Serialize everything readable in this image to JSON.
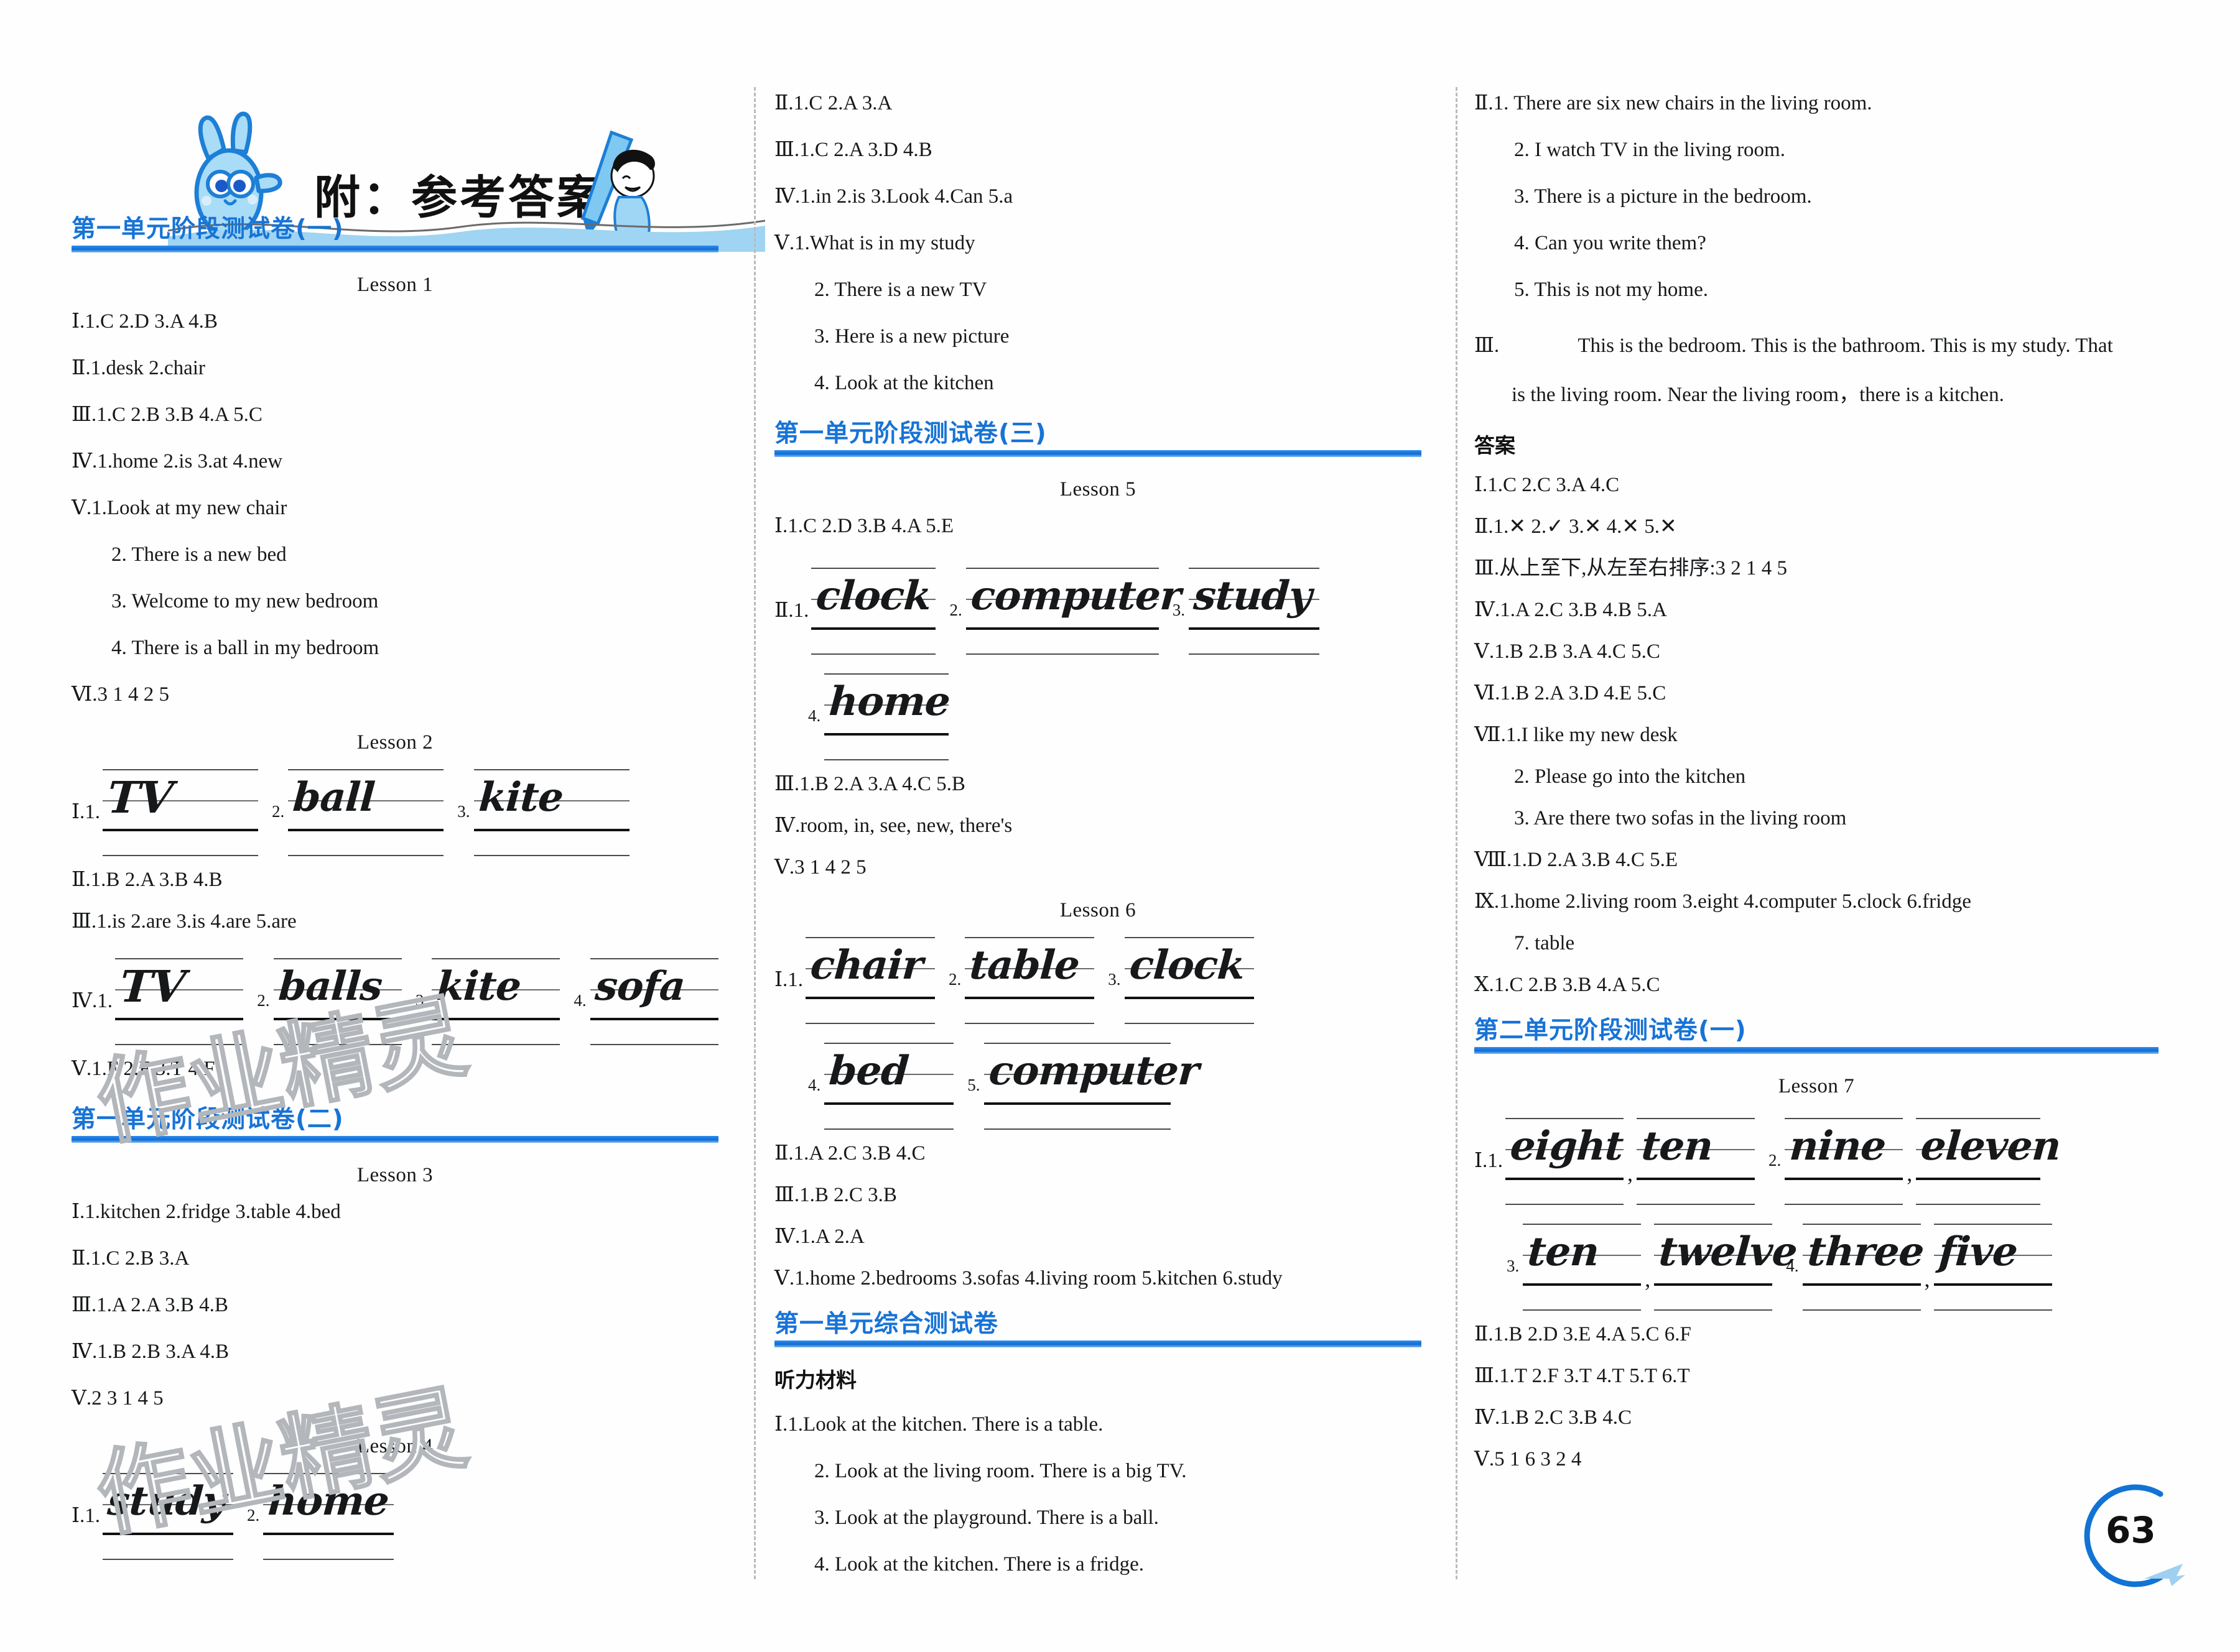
{
  "header": {
    "title": "附：参考答案"
  },
  "page": {
    "number": "63"
  },
  "watermark": {
    "text": "作业精灵"
  },
  "column1": {
    "section1": {
      "title": "第一单元阶段测试卷(一)"
    },
    "lesson1": {
      "label": "Lesson 1",
      "items": [
        "Ⅰ.1.C  2.D  3.A  4.B",
        "Ⅱ.1.desk  2.chair",
        "Ⅲ.1.C  2.B  3.B  4.A  5.C",
        "Ⅳ.1.home  2.is  3.at  4.new",
        "Ⅴ.1.Look at my new chair"
      ],
      "sub": [
        "2. There is a new bed",
        "3. Welcome to my new bedroom",
        "4. There is a ball in my bedroom"
      ],
      "last": "Ⅵ.3  1  4  2  5"
    },
    "lesson2": {
      "label": "Lesson 2",
      "q1_label": "Ⅰ.1.",
      "q1_words": [
        "TV",
        "ball",
        "kite"
      ],
      "q1_nums": [
        "2.",
        "3."
      ],
      "items": [
        "Ⅱ.1.B  2.A  3.B  4.B",
        "Ⅲ.1.is  2.are  3.is  4.are  5.are"
      ],
      "q4_label": "Ⅳ.1.",
      "q4_words": [
        "TV",
        "balls",
        "kite",
        "sofa"
      ],
      "q4_nums": [
        "2.",
        "3.",
        "4."
      ],
      "last": "Ⅴ.1.F  2.F  3.T  4.F"
    },
    "section2": {
      "title": "第一单元阶段测试卷(二)"
    },
    "lesson3": {
      "label": "Lesson 3",
      "items": [
        "Ⅰ.1.kitchen  2.fridge  3.table  4.bed",
        "Ⅱ.1.C  2.B  3.A",
        "Ⅲ.1.A  2.A  3.B  4.B",
        "Ⅳ.1.B  2.B  3.A  4.B",
        "Ⅴ.2  3  1  4  5"
      ]
    },
    "lesson4": {
      "label": "Lesson 4",
      "q1_label": "Ⅰ.1.",
      "q1_words": [
        "study",
        "home"
      ],
      "q1_nums": [
        "2."
      ]
    }
  },
  "column2": {
    "lesson1cont": {
      "items": [
        "Ⅱ.1.C  2.A  3.A",
        "Ⅲ.1.C  2.A  3.D  4.B",
        "Ⅳ.1.in  2.is  3.Look  4.Can  5.a",
        "Ⅴ.1.What is in my study"
      ],
      "sub": [
        "2. There is a new TV",
        "3. Here is a new picture",
        "4. Look at the kitchen"
      ]
    },
    "section3": {
      "title": "第一单元阶段测试卷(三)"
    },
    "lesson5": {
      "label": "Lesson 5",
      "first": "Ⅰ.1.C  2.D  3.B  4.A  5.E",
      "q2_label": "Ⅱ.1.",
      "q2_words": [
        "clock",
        "computer",
        "study"
      ],
      "q2_nums": [
        "2.",
        "3."
      ],
      "q2_row2_num": "4.",
      "q2_row2_word": "home",
      "items": [
        "Ⅲ.1.B  2.A  3.A  4.C  5.B",
        "Ⅳ.room, in, see, new, there's",
        "Ⅴ.3  1  4  2  5"
      ]
    },
    "lesson6": {
      "label": "Lesson 6",
      "q1_label": "Ⅰ.1.",
      "q1_words": [
        "chair",
        "table",
        "clock"
      ],
      "q1_nums": [
        "2.",
        "3."
      ],
      "q1_row2_nums": [
        "4.",
        "5."
      ],
      "q1_row2_words": [
        "bed",
        "computer"
      ],
      "items": [
        "Ⅱ.1.A  2.C  3.B  4.C",
        "Ⅲ.1.B  2.C  3.B",
        "Ⅳ.1.A  2.A",
        "Ⅴ.1.home  2.bedrooms  3.sofas  4.living room  5.kitchen  6.study"
      ]
    },
    "section4": {
      "title": "第一单元综合测试卷"
    },
    "listening": {
      "heading": "听力材料",
      "first": "Ⅰ.1.Look at the kitchen. There is a table.",
      "sub": [
        "2. Look at the living room. There is a big TV.",
        "3. Look at the playground. There is a ball.",
        "4. Look at the kitchen. There is a fridge."
      ]
    }
  },
  "column3": {
    "listening_cont": {
      "first": "Ⅱ.1. There are six new chairs in the living room.",
      "sub": [
        "2. I watch TV in the living room.",
        "3. There is a picture in the bedroom.",
        "4. Can you write them?",
        "5. This is not my home."
      ],
      "para_marker": "Ⅲ.",
      "para_line1": "This is the bedroom. This is the bathroom. This is my study. That",
      "para_line2": "is the living room. Near the living room，there is a kitchen."
    },
    "answers": {
      "heading": "答案",
      "items": [
        "Ⅰ.1.C  2.C  3.A  4.C",
        "Ⅱ.1.✕  2.✓  3.✕  4.✕  5.✕",
        "Ⅲ.从上至下,从左至右排序:3  2  1  4  5",
        "Ⅳ.1.A  2.C  3.B  4.B  5.A",
        "Ⅴ.1.B  2.B  3.A  4.C  5.C",
        "Ⅵ.1.B  2.A  3.D  4.E  5.C",
        "Ⅶ.1.I like my new desk"
      ],
      "sub": [
        "2. Please go into the kitchen",
        "3. Are there two sofas in the living room"
      ],
      "items2": [
        "Ⅷ.1.D  2.A  3.B  4.C  5.E",
        "Ⅸ.1.home  2.living room  3.eight  4.computer  5.clock  6.fridge"
      ],
      "sub2": "7. table",
      "items3": [
        "Ⅹ.1.C  2.B  3.B  4.A  5.C"
      ]
    },
    "section5": {
      "title": "第二单元阶段测试卷(一)"
    },
    "lesson7": {
      "label": "Lesson 7",
      "q1_label": "Ⅰ.1.",
      "row1": {
        "words": [
          "eight",
          "ten"
        ],
        "num2": "2.",
        "words2": [
          "nine",
          "eleven"
        ]
      },
      "row2": {
        "num3": "3.",
        "words": [
          "ten",
          "twelve"
        ],
        "num4": "4.",
        "words2": [
          "three",
          "five"
        ]
      },
      "items": [
        "Ⅱ.1.B  2.D  3.E  4.A  5.C  6.F",
        "Ⅲ.1.T  2.F  3.T  4.T  5.T  6.T",
        "Ⅳ.1.B  2.C  3.B  4.C",
        "Ⅴ.5  1  6  3  2  4"
      ]
    }
  }
}
